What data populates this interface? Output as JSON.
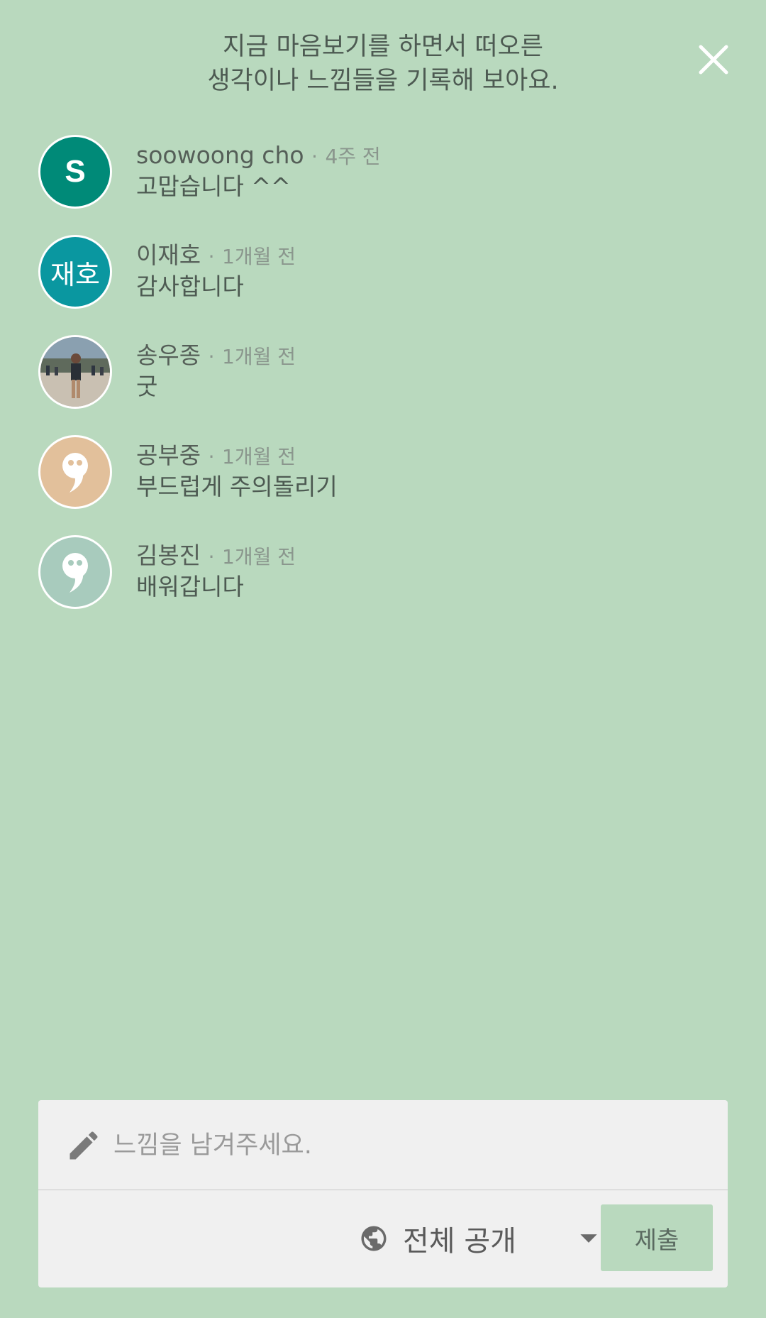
{
  "header": {
    "title_line1": "지금 마음보기를 하면서 떠오른",
    "title_line2": "생각이나 느낌들을 기록해 보아요."
  },
  "comments": [
    {
      "author": "soowoong cho",
      "time": "4주 전",
      "text": "고맙습니다 ^^",
      "avatar_text": "S",
      "avatar_color": "#008a78"
    },
    {
      "author": "이재호",
      "time": "1개월 전",
      "text": "감사합니다",
      "avatar_text": "재호",
      "avatar_color": "#0a97a0"
    },
    {
      "author": "송우종",
      "time": "1개월 전",
      "text": "굿",
      "avatar_text": "",
      "avatar_color": "#a7a29a"
    },
    {
      "author": "공부중",
      "time": "1개월 전",
      "text": "부드럽게 주의돌리기",
      "avatar_text": "",
      "avatar_color": "#e2c09b"
    },
    {
      "author": "김봉진",
      "time": "1개월 전",
      "text": "배워갑니다",
      "avatar_text": "",
      "avatar_color": "#a8cbbd"
    }
  ],
  "separator": "·",
  "composer": {
    "placeholder": "느낌을 남겨주세요.",
    "visibility_label": "전체 공개",
    "submit_label": "제출"
  },
  "icons": {
    "close": "close-icon",
    "pencil": "pencil-icon",
    "globe": "globe-icon",
    "dropdown": "chevron-down-icon"
  },
  "colors": {
    "background": "#b9d9be",
    "card": "#f0f0f0",
    "submit": "#b9d9be"
  }
}
